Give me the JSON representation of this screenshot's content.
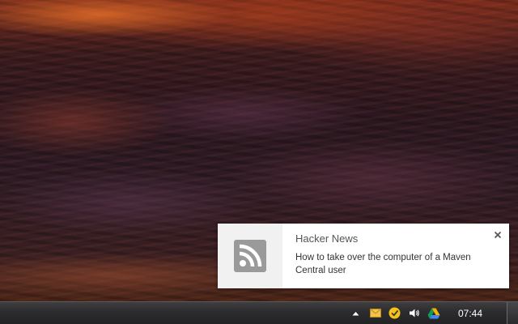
{
  "notification": {
    "app_icon": "rss-feed-icon",
    "title": "Hacker News",
    "message": "How to take over the computer of a Maven Central user",
    "close_icon": "close-icon"
  },
  "taskbar": {
    "tray_icons": [
      "show-hidden-icons-arrow",
      "mail-icon",
      "norton-security-icon",
      "speaker-volume-icon",
      "google-drive-icon"
    ],
    "clock": "07:44"
  },
  "colors": {
    "toast_background": "#ffffff",
    "toast_icon_area": "#f1f1f1",
    "rss_icon": "#9a9a9a",
    "taskbar": "#2c2c2e",
    "clock_text": "#ffffff"
  }
}
